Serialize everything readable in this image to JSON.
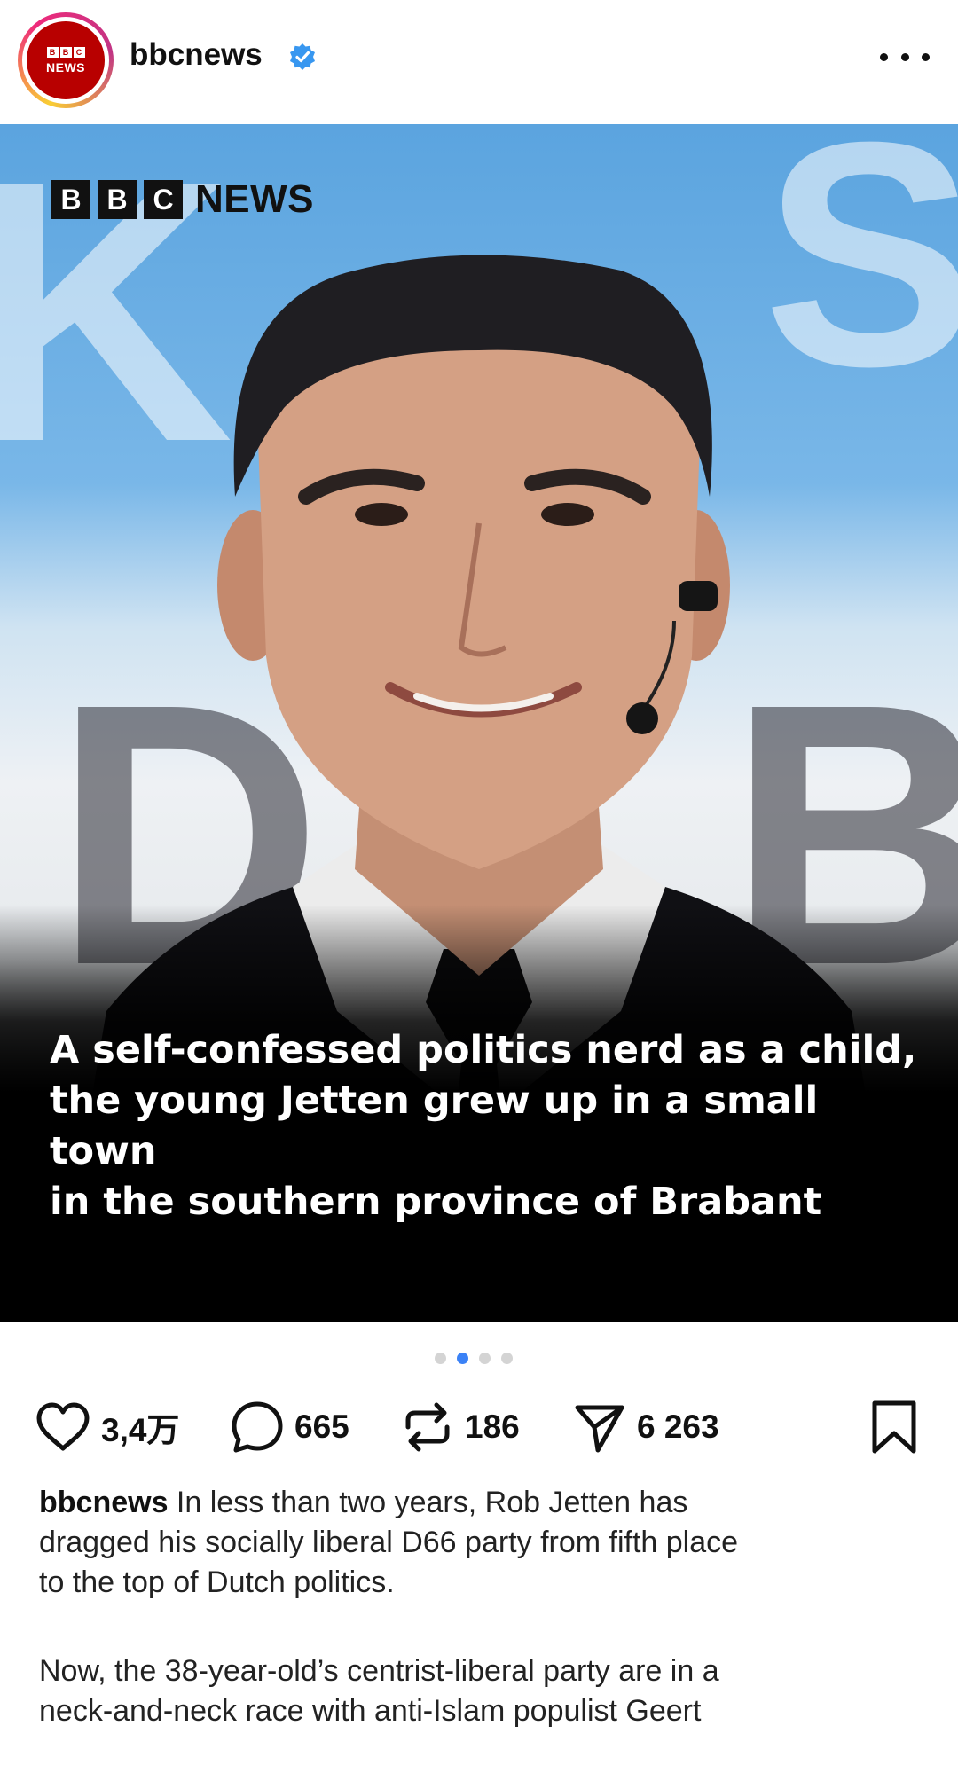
{
  "header": {
    "username": "bbcnews",
    "avatar_blocks": [
      "B",
      "B",
      "C"
    ],
    "avatar_news": "NEWS"
  },
  "image": {
    "brand_blocks": [
      "B",
      "B",
      "C"
    ],
    "brand_news": "NEWS",
    "caption_lines": [
      "A self-confessed politics nerd as a child,",
      "the young Jetten grew up in a small town",
      "in the southern province of Brabant"
    ],
    "carousel_count": 4,
    "carousel_active": 1
  },
  "actions": {
    "likes": "3,4万",
    "comments": "665",
    "reposts": "186",
    "shares": "6 263"
  },
  "post": {
    "author": "bbcnews",
    "text_lines": [
      " In less than two years, Rob Jetten has",
      "dragged his socially liberal D66 party from fifth place",
      "to the top of Dutch politics."
    ],
    "text2_lines": [
      "Now, the 38-year-old’s centrist-liberal party are in a",
      "neck-and-neck race with anti-Islam populist Geert"
    ]
  },
  "colors": {
    "bbc_red": "#b80000",
    "verified_blue": "#3897f0",
    "dot_active": "#3b82f6"
  },
  "icons": [
    "bbc-news-avatar",
    "verified-badge-icon",
    "more-options-icon",
    "heart-icon",
    "comment-icon",
    "repost-icon",
    "share-icon",
    "bookmark-icon"
  ]
}
